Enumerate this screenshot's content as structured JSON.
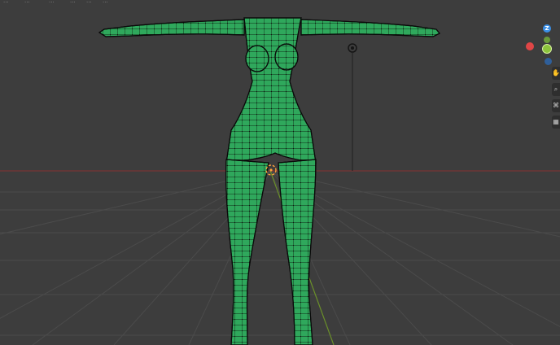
{
  "header": {
    "menu_items": [
      "...",
      "...",
      "...",
      "...",
      "...",
      "..."
    ]
  },
  "gizmo": {
    "z_label": "Z",
    "colors": {
      "x": "#e04646",
      "y": "#8cc43c",
      "z": "#3b8fe6",
      "neg": "#5a5a5a"
    }
  },
  "scene": {
    "background": "#3d3d3d",
    "grid_color": "#4a4a4a",
    "x_axis_color": "#8a3a3a",
    "y_axis_color": "#6f8f2e",
    "mesh_fill": "#2fa85c",
    "mesh_wire": "#111111",
    "origin_color": "#ffa23c"
  },
  "nav_tools": [
    {
      "icon": "hand-pan-icon"
    },
    {
      "icon": "zoom-magnifier-icon"
    },
    {
      "icon": "camera-icon"
    },
    {
      "icon": "perspective-grid-icon"
    }
  ]
}
